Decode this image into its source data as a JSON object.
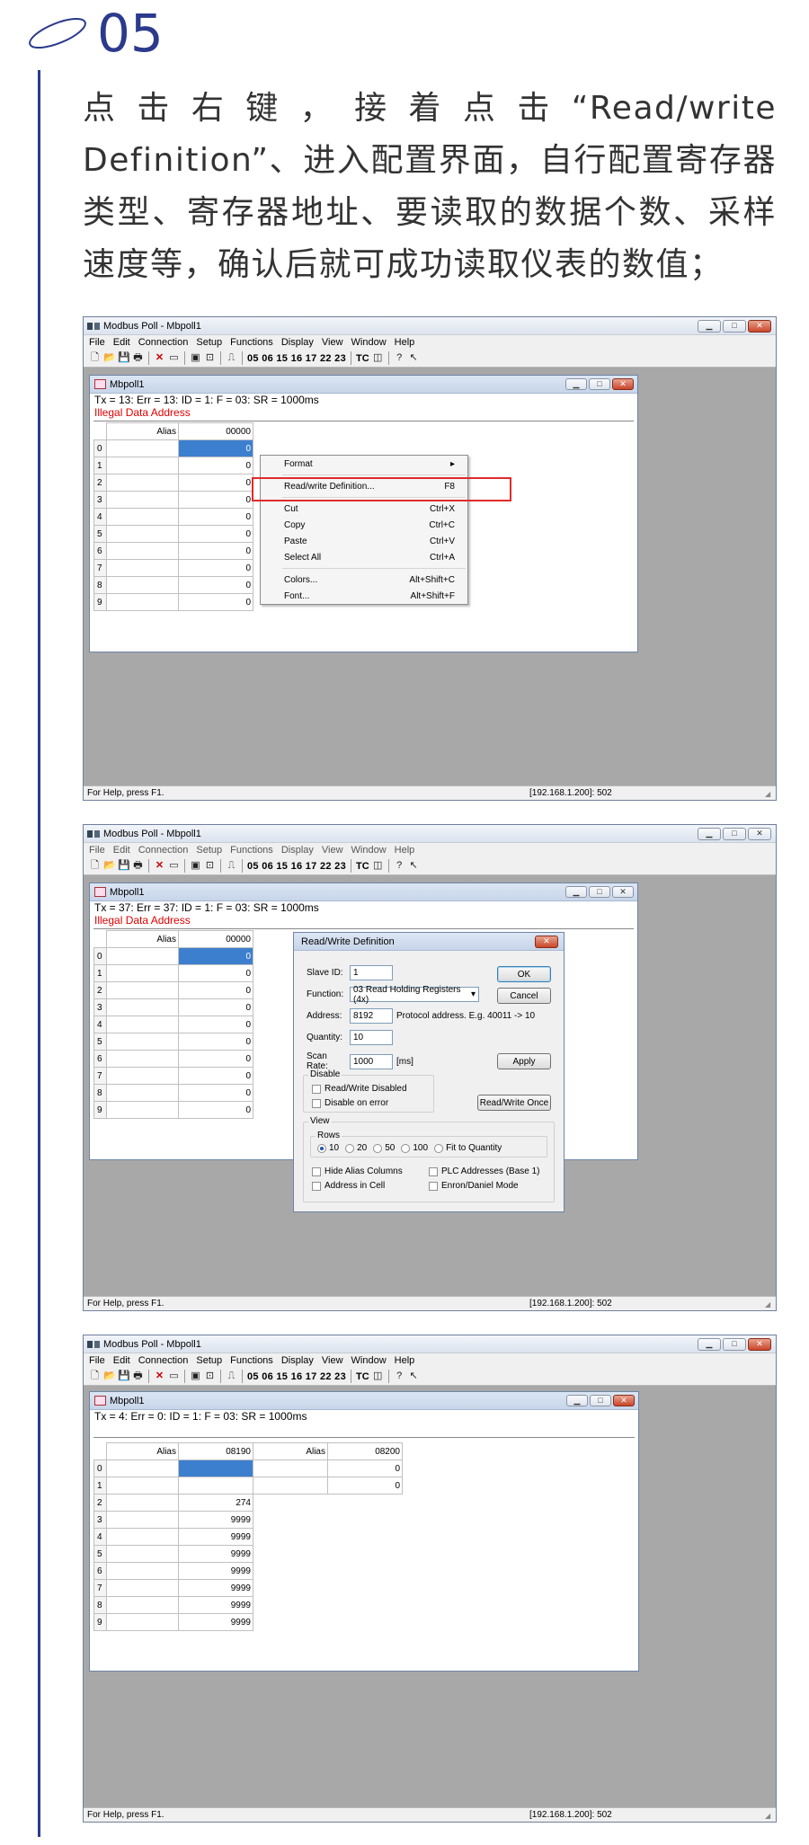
{
  "step": {
    "number": "05"
  },
  "intro_text": "点击右键，接着点击“Read/write Definition”、进入配置界面，自行配置寄存器类型、寄存器地址、要读取的数据个数、采样速度等，确认后就可成功读取仪表的数值；",
  "app": {
    "title": "Modbus Poll - Mbpoll1",
    "menu": [
      "File",
      "Edit",
      "Connection",
      "Setup",
      "Functions",
      "Display",
      "View",
      "Window",
      "Help"
    ],
    "toolbar_codes": "05 06 15 16 17 22 23",
    "toolbar_tc": "TC",
    "status_help": "For Help, press F1.",
    "status_ip": "[192.168.1.200]: 502"
  },
  "shot1": {
    "doc_title": "Mbpoll1",
    "status": "Tx = 13: Err = 13: ID = 1: F = 03: SR = 1000ms",
    "error": "Illegal Data Address",
    "col_alias": "Alias",
    "col_addr": "00000",
    "rows": [
      {
        "n": "0",
        "v": "0"
      },
      {
        "n": "1",
        "v": "0"
      },
      {
        "n": "2",
        "v": "0"
      },
      {
        "n": "3",
        "v": "0"
      },
      {
        "n": "4",
        "v": "0"
      },
      {
        "n": "5",
        "v": "0"
      },
      {
        "n": "6",
        "v": "0"
      },
      {
        "n": "7",
        "v": "0"
      },
      {
        "n": "8",
        "v": "0"
      },
      {
        "n": "9",
        "v": "0"
      }
    ],
    "context_menu": {
      "format": "Format",
      "rw_def": "Read/write Definition...",
      "rw_def_key": "F8",
      "cut": "Cut",
      "cut_key": "Ctrl+X",
      "copy": "Copy",
      "copy_key": "Ctrl+C",
      "paste": "Paste",
      "paste_key": "Ctrl+V",
      "select_all": "Select All",
      "select_all_key": "Ctrl+A",
      "colors": "Colors...",
      "colors_key": "Alt+Shift+C",
      "font": "Font...",
      "font_key": "Alt+Shift+F"
    }
  },
  "shot2": {
    "doc_title": "Mbpoll1",
    "status": "Tx = 37: Err = 37: ID = 1: F = 03: SR = 1000ms",
    "error": "Illegal Data Address",
    "col_alias": "Alias",
    "col_addr": "00000",
    "rows": [
      {
        "n": "0",
        "v": "0"
      },
      {
        "n": "1",
        "v": "0"
      },
      {
        "n": "2",
        "v": "0"
      },
      {
        "n": "3",
        "v": "0"
      },
      {
        "n": "4",
        "v": "0"
      },
      {
        "n": "5",
        "v": "0"
      },
      {
        "n": "6",
        "v": "0"
      },
      {
        "n": "7",
        "v": "0"
      },
      {
        "n": "8",
        "v": "0"
      },
      {
        "n": "9",
        "v": "0"
      }
    ],
    "dialog": {
      "title": "Read/Write Definition",
      "slave_id_label": "Slave ID:",
      "slave_id": "1",
      "function_label": "Function:",
      "function": "03 Read Holding Registers (4x)",
      "address_label": "Address:",
      "address": "8192",
      "protocol_note": "Protocol address. E.g. 40011 -> 10",
      "quantity_label": "Quantity:",
      "quantity": "10",
      "scan_rate_label": "Scan Rate:",
      "scan_rate": "1000",
      "scan_unit": "[ms]",
      "ok": "OK",
      "cancel": "Cancel",
      "apply": "Apply",
      "disable_group": "Disable",
      "rw_disabled": "Read/Write Disabled",
      "disable_on_error": "Disable on error",
      "rw_once": "Read/Write Once",
      "view_group": "View",
      "rows_group": "Rows",
      "rows_options": [
        "10",
        "20",
        "50",
        "100",
        "Fit to Quantity"
      ],
      "rows_selected": "10",
      "hide_alias": "Hide Alias Columns",
      "plc_addresses": "PLC Addresses (Base 1)",
      "address_in_cell": "Address in Cell",
      "enron": "Enron/Daniel Mode"
    }
  },
  "shot3": {
    "doc_title": "Mbpoll1",
    "status": "Tx = 4: Err = 0: ID = 1: F = 03: SR = 1000ms",
    "col_alias": "Alias",
    "col_addr1": "08190",
    "col_alias2": "Alias",
    "col_addr2": "08200",
    "rows": [
      {
        "n": "0",
        "v1": "",
        "v2": "0"
      },
      {
        "n": "1",
        "v1": "",
        "v2": "0"
      },
      {
        "n": "2",
        "v1": "274",
        "v2": ""
      },
      {
        "n": "3",
        "v1": "9999",
        "v2": ""
      },
      {
        "n": "4",
        "v1": "9999",
        "v2": ""
      },
      {
        "n": "5",
        "v1": "9999",
        "v2": ""
      },
      {
        "n": "6",
        "v1": "9999",
        "v2": ""
      },
      {
        "n": "7",
        "v1": "9999",
        "v2": ""
      },
      {
        "n": "8",
        "v1": "9999",
        "v2": ""
      },
      {
        "n": "9",
        "v1": "9999",
        "v2": ""
      }
    ]
  }
}
